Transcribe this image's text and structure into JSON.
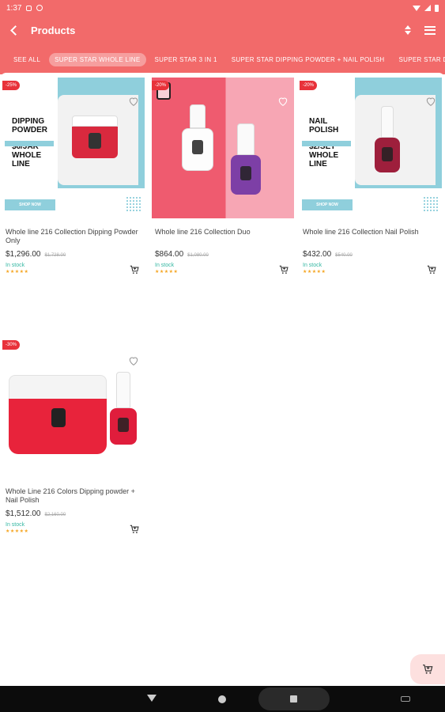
{
  "status_bar": {
    "time": "1:37"
  },
  "app_bar": {
    "title": "Products"
  },
  "categories": [
    {
      "label": "SEE ALL"
    },
    {
      "label": "SUPER STAR WHOLE LINE",
      "active": true
    },
    {
      "label": "SUPER STAR 3 IN 1"
    },
    {
      "label": "SUPER STAR DIPPING POWDER + NAIL POLISH"
    },
    {
      "label": "SUPER STAR DI"
    }
  ],
  "products": [
    {
      "discount": "-25%",
      "banner_lines": [
        "DIPPING",
        "POWDER",
        "$6/JAR",
        "WHOLE",
        "LINE"
      ],
      "shop_now": "SHOP NOW",
      "name": "Whole line 216 Collection Dipping Powder Only",
      "price": "$1,296.00",
      "old_price": "$1,728.00",
      "stock": "In stock",
      "rating": 0
    },
    {
      "discount": "-20%",
      "name": "Whole line 216 Collection Duo",
      "price": "$864.00",
      "old_price": "$1,080.00",
      "stock": "In stock",
      "rating": 0
    },
    {
      "discount": "-20%",
      "banner_lines": [
        "NAIL",
        "POLISH",
        "$2/SET",
        "WHOLE",
        "LINE"
      ],
      "shop_now": "SHOP NOW",
      "name": "Whole line 216 Collection Nail Polish",
      "price": "$432.00",
      "old_price": "$540.00",
      "stock": "In stock",
      "rating": 0
    },
    {
      "discount": "-30%",
      "name": "Whole Line 216 Colors Dipping powder + Nail Polish",
      "price": "$1,512.00",
      "old_price": "$2,160.00",
      "stock": "In stock",
      "rating": 0
    }
  ],
  "icons": {
    "back": "chevron-left-icon",
    "sort": "sort-icon",
    "menu": "hamburger-menu-icon",
    "favorite": "heart-outline-icon",
    "add_to_cart": "cart-add-icon"
  },
  "colors": {
    "primary": "#f26a6a",
    "discount": "#e8323a",
    "in_stock": "#35b7a2",
    "star": "#f5a623",
    "banner_blue": "#8fcfdc"
  }
}
